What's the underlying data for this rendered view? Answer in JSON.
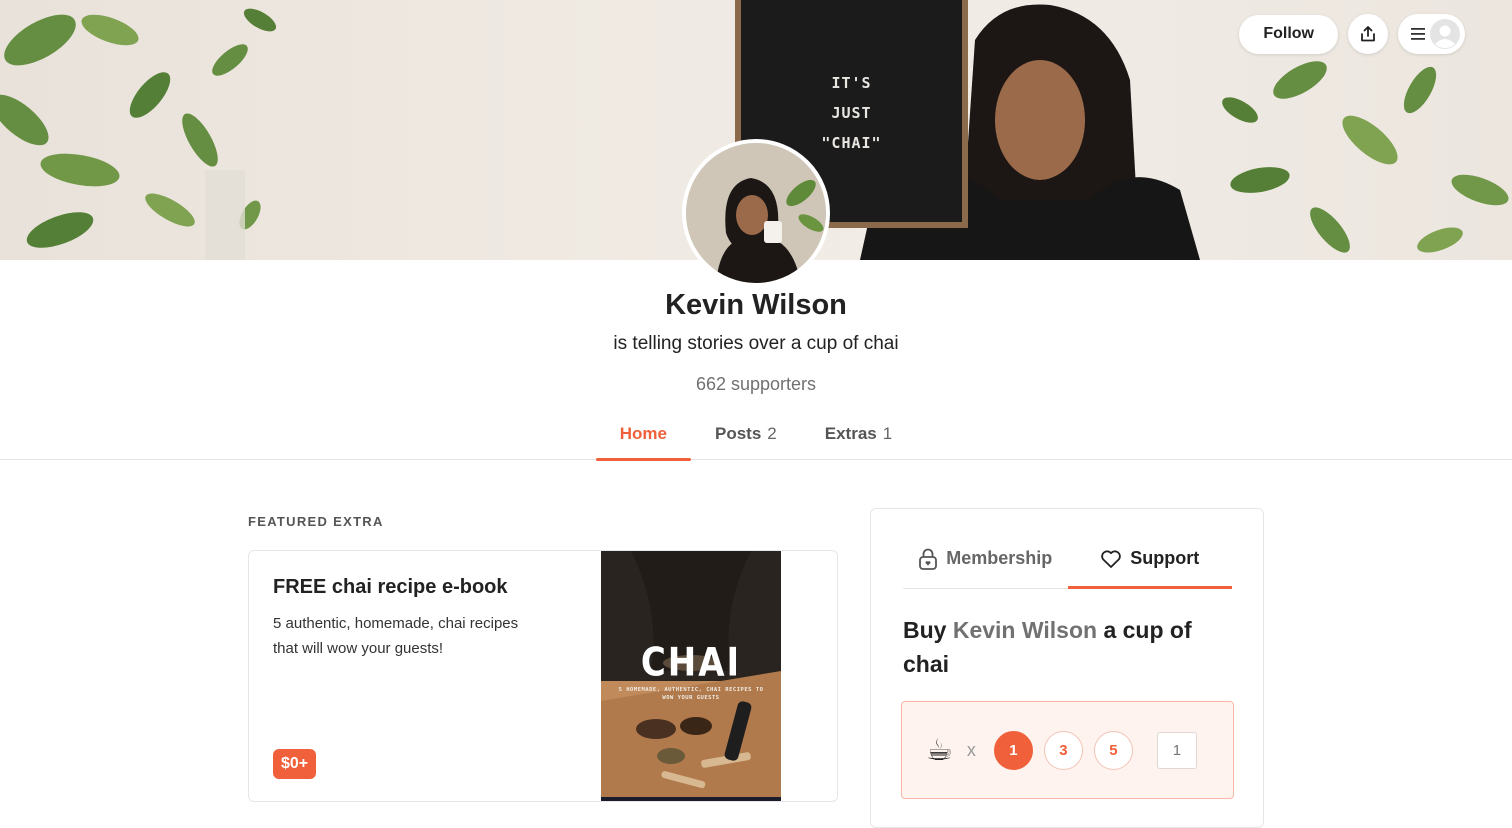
{
  "cover": {
    "letterboard_lines": [
      "IT'S",
      "JUST",
      "\"CHAI\""
    ]
  },
  "topbar": {
    "follow_label": "Follow",
    "share_icon": "share-icon",
    "menu_icon": "hamburger-icon",
    "user_icon": "user-avatar-icon"
  },
  "profile": {
    "name": "Kevin Wilson",
    "tagline": "is telling stories over a cup of chai",
    "supporters": "662 supporters"
  },
  "tabs": [
    {
      "label": "Home",
      "count": "",
      "active": true
    },
    {
      "label": "Posts",
      "count": "2",
      "active": false
    },
    {
      "label": "Extras",
      "count": "1",
      "active": false
    }
  ],
  "featured": {
    "section_label": "FEATURED EXTRA",
    "title": "FREE chai recipe e-book",
    "description": "5 authentic, homemade, chai recipes that will wow your guests!",
    "price": "$0+",
    "ebook_title": "CHAI",
    "ebook_subtitle": "5 HOMEMADE, AUTHENTIC, CHAI RECIPES TO WOW YOUR GUESTS"
  },
  "support": {
    "tabs": [
      {
        "label": "Membership",
        "icon": "lock-icon",
        "active": false
      },
      {
        "label": "Support",
        "icon": "heart-icon",
        "active": true
      }
    ],
    "heading_pre": "Buy",
    "heading_name": "Kevin Wilson",
    "heading_post": "a cup of chai",
    "item_emoji": "☕",
    "multiplier": "x",
    "quantities": [
      "1",
      "3",
      "5"
    ],
    "selected_quantity": "1",
    "custom_placeholder": "1"
  },
  "colors": {
    "accent": "#f0603a",
    "muted": "#717171"
  }
}
